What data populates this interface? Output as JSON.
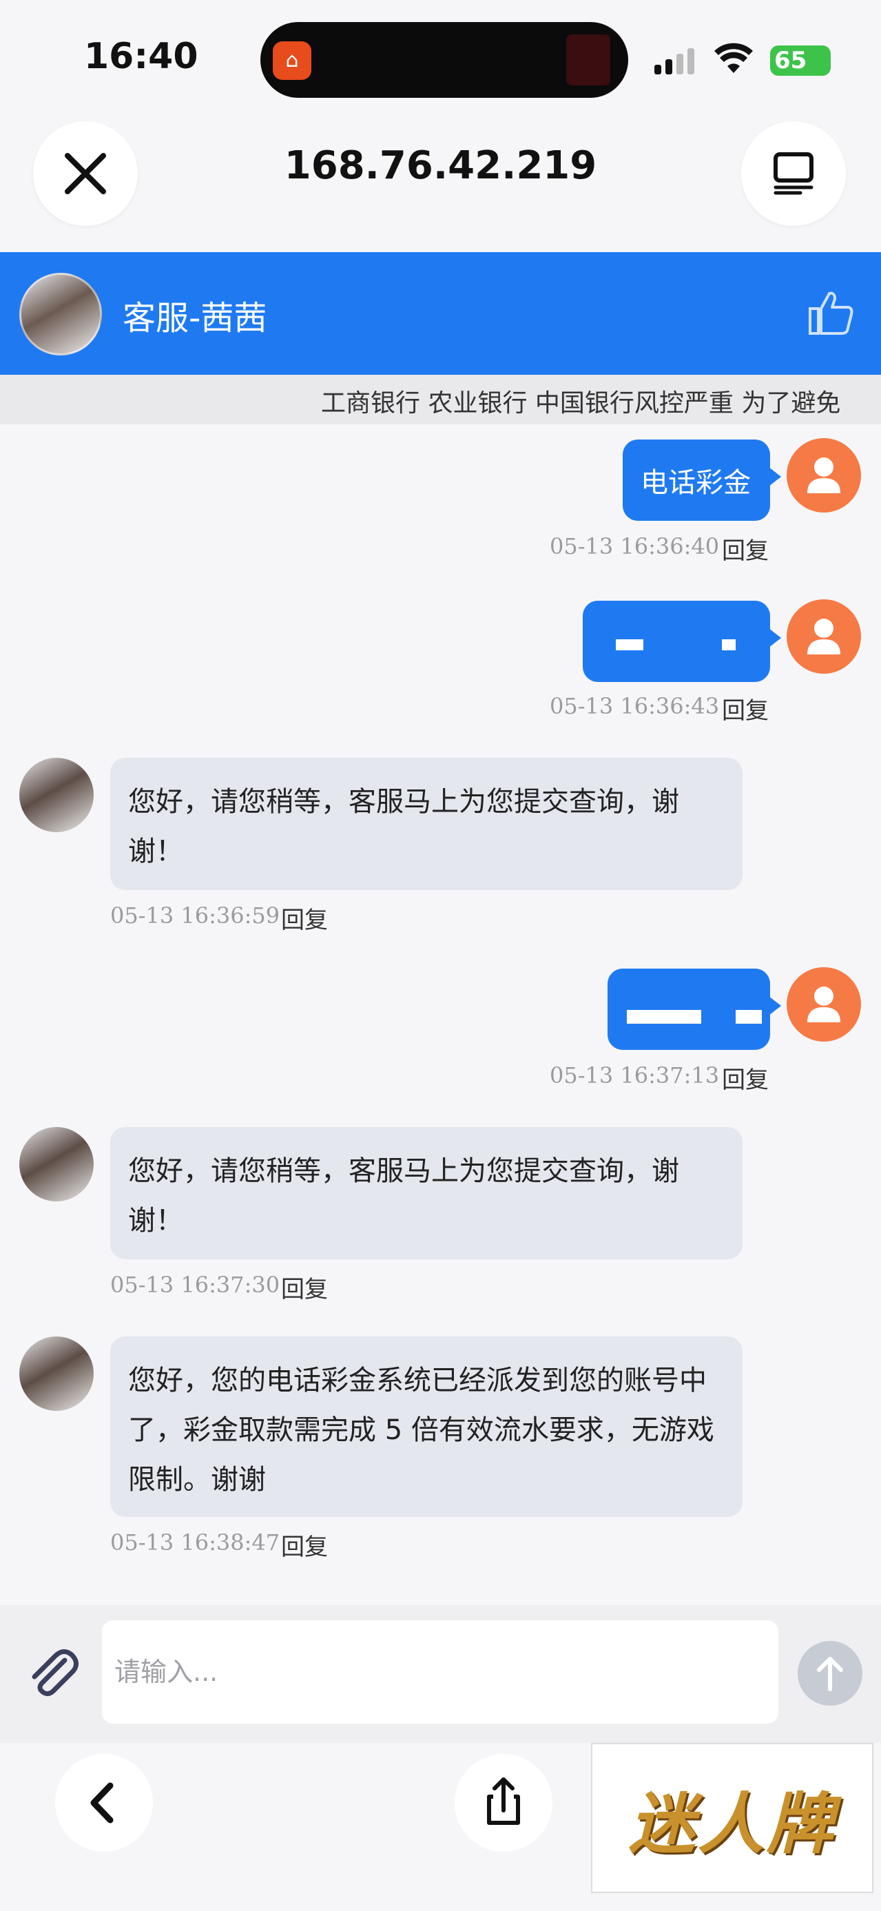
{
  "status_bar": {
    "time": "16:40",
    "battery": "65"
  },
  "browser": {
    "url": "168.76.42.219"
  },
  "chat": {
    "agent_name": "客服-茜茜",
    "marquee": "工商银行 农业银行 中国银行风控严重 为了避免"
  },
  "messages": [
    {
      "from": "user",
      "text": "电话彩金",
      "time": "05-13 16:36:40",
      "reply": "回复"
    },
    {
      "from": "user",
      "text": "",
      "time": "05-13 16:36:43",
      "reply": "回复"
    },
    {
      "from": "agent",
      "text": "您好，请您稍等，客服马上为您提交查询，谢谢！",
      "time": "05-13 16:36:59",
      "reply": "回复"
    },
    {
      "from": "user",
      "text": "",
      "time": "05-13 16:37:13",
      "reply": "回复"
    },
    {
      "from": "agent",
      "text": "您好，请您稍等，客服马上为您提交查询，谢谢！",
      "time": "05-13 16:37:30",
      "reply": "回复"
    },
    {
      "from": "agent",
      "text": "您好，您的电话彩金系统已经派发到您的账号中了，彩金取款需完成 5 倍有效流水要求，无游戏限制。谢谢",
      "time": "05-13 16:38:47",
      "reply": "回复"
    }
  ],
  "input": {
    "placeholder": "请输入..."
  },
  "watermark": "迷人牌",
  "colors": {
    "brand_blue": "#1f7af2",
    "user_avatar": "#f57a45",
    "agent_bubble": "#e4e7ee"
  },
  "icons": [
    "close-icon",
    "tabs-icon",
    "thumbs-up-icon",
    "user-icon",
    "paperclip-icon",
    "arrow-up-icon",
    "chevron-left-icon",
    "share-icon"
  ]
}
